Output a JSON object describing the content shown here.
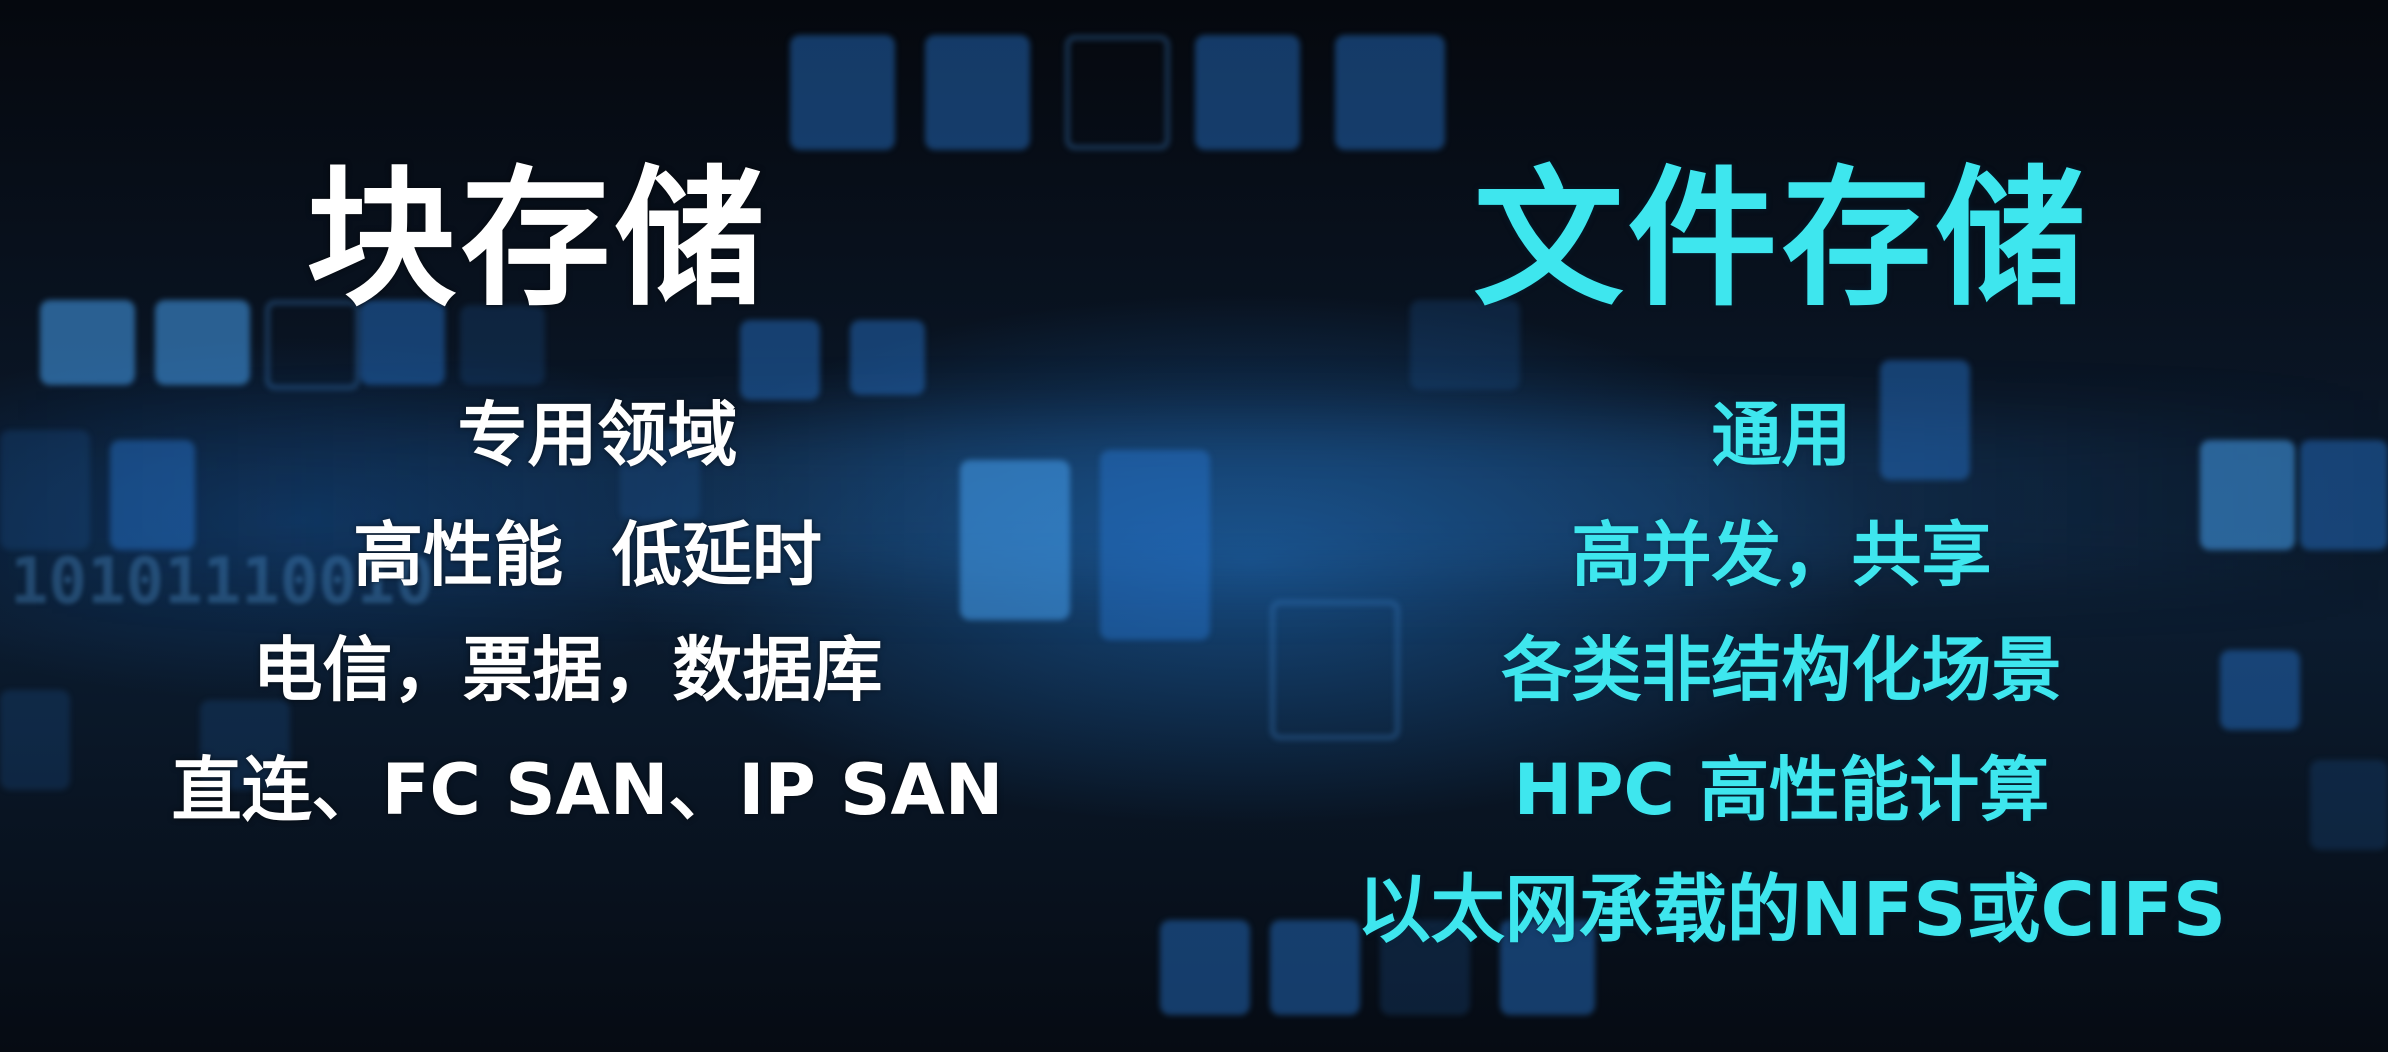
{
  "block_storage": {
    "title": "块存储",
    "lines": [
      "专用领域",
      "高性能  低延时",
      "电信，票据，数据库",
      "直连、FC SAN、IP SAN"
    ]
  },
  "file_storage": {
    "title": "文件存储",
    "lines": [
      "通用",
      "高并发，共享",
      "各类非结构化场景",
      "HPC 高性能计算",
      "以太网承载的NFS或CIFS"
    ]
  },
  "background": {
    "binary_text": "10101110010"
  },
  "colors": {
    "left_text": "#ffffff",
    "right_text": "#3ee6ee",
    "background": "#060b13",
    "tile_blue": "#2878d2"
  }
}
